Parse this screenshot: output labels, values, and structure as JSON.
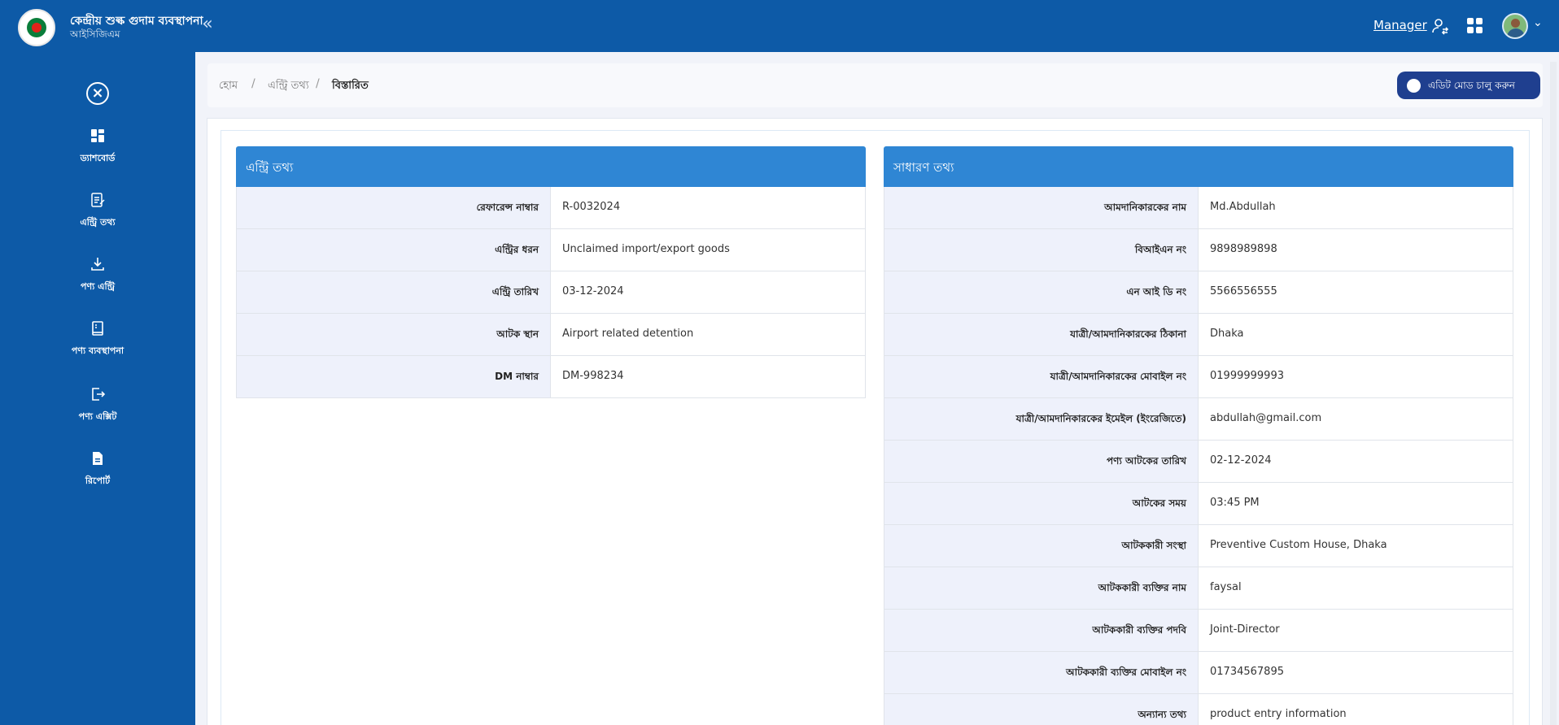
{
  "app": {
    "title": "কেন্দ্রীয় শুল্ক গুদাম ব্যবস্থাপনা",
    "subtitle": "আইসিজিএম"
  },
  "header": {
    "role_label": "Manager",
    "icons": {
      "collapse": "double-chevron-left-icon",
      "role": "user-switch-icon",
      "apps": "grid-icon",
      "avatar": "user-avatar"
    }
  },
  "sidebar": {
    "items": [
      {
        "label": "ড্যাশবোর্ড",
        "icon": "dashboard-icon"
      },
      {
        "label": "এন্ট্রি তথ্য",
        "icon": "entry-edit-icon"
      },
      {
        "label": "পণ্য এন্ট্রি",
        "icon": "download-icon"
      },
      {
        "label": "পণ্য ব্যবস্থাপনা",
        "icon": "book-icon"
      },
      {
        "label": "পণ্য এক্সিট",
        "icon": "logout-icon"
      },
      {
        "label": "রিপোর্ট",
        "icon": "report-file-icon"
      }
    ]
  },
  "breadcrumb": {
    "items": [
      "হোম",
      "এন্ট্রি তথ্য",
      "বিস্তারিত"
    ],
    "separator": "/"
  },
  "edit_mode": {
    "label": "এডিট মোড চালু করুন",
    "on": false
  },
  "entry_panel": {
    "title": "এন্ট্রি তথ্য",
    "rows": [
      {
        "key": "রেফারেন্স নাম্বার",
        "value": "R-0032024"
      },
      {
        "key": "এন্ট্রির ধরন",
        "value": "Unclaimed import/export goods"
      },
      {
        "key": "এন্ট্রি তারিখ",
        "value": "03-12-2024"
      },
      {
        "key": "আটক স্থান",
        "value": "Airport related detention"
      },
      {
        "key": "DM নাম্বার",
        "value": "DM-998234"
      }
    ]
  },
  "general_panel": {
    "title": "সাধারণ তথ্য",
    "rows": [
      {
        "key": "আমদানিকারকের নাম",
        "value": "Md.Abdullah"
      },
      {
        "key": "বিআইএন নং",
        "value": "9898989898"
      },
      {
        "key": "এন আই ডি নং",
        "value": "5566556555"
      },
      {
        "key": "যাত্রী/আমদানিকারকের ঠিকানা",
        "value": "Dhaka"
      },
      {
        "key": "যাত্রী/আমদানিকারকের মোবাইল নং",
        "value": "01999999993"
      },
      {
        "key": "যাত্রী/আমদানিকারকের ইমেইল (ইংরেজিতে)",
        "value": "abdullah@gmail.com"
      },
      {
        "key": "পণ্য আটকের তারিখ",
        "value": "02-12-2024"
      },
      {
        "key": "আটকের সময়",
        "value": "03:45 PM"
      },
      {
        "key": "আটককারী সংস্থা",
        "value": "Preventive Custom House, Dhaka"
      },
      {
        "key": "আটককারী ব্যক্তির নাম",
        "value": "faysal"
      },
      {
        "key": "আটককারী ব্যক্তির পদবি",
        "value": "Joint-Director"
      },
      {
        "key": "আটককারী ব্যক্তির মোবাইল নং",
        "value": "01734567895"
      },
      {
        "key": "অন্যান্য তথ্য",
        "value": "product entry information"
      }
    ]
  },
  "colors": {
    "primary": "#0d5aa7",
    "panel_header": "#2f86d4",
    "edit_button": "#1f3f8f",
    "key_cell": "#eef1fb"
  }
}
